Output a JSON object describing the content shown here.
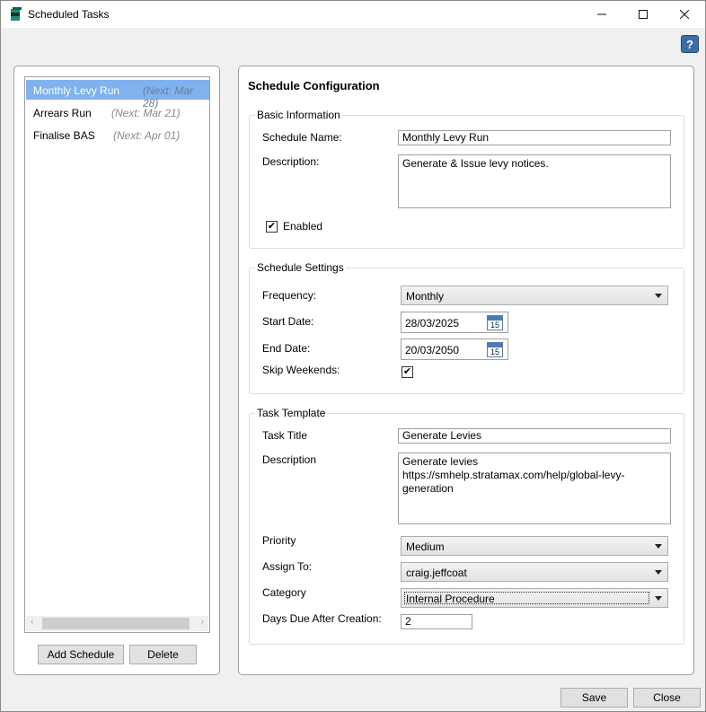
{
  "window": {
    "title": "Scheduled Tasks",
    "minimize_icon": "minimize-icon",
    "maximize_icon": "maximize-icon",
    "close_icon": "close-icon",
    "help_label": "?"
  },
  "schedules": [
    {
      "name": "Monthly Levy Run",
      "next": "(Next: Mar 28)",
      "selected": true
    },
    {
      "name": "Arrears Run",
      "next": "(Next: Mar 21)",
      "selected": false
    },
    {
      "name": "Finalise BAS",
      "next": "(Next: Apr 01)",
      "selected": false
    }
  ],
  "left_buttons": {
    "add": "Add Schedule",
    "delete": "Delete"
  },
  "config": {
    "title": "Schedule Configuration",
    "basic": {
      "legend": "Basic Information",
      "name_label": "Schedule Name:",
      "name_value": "Monthly Levy Run",
      "desc_label": "Description:",
      "desc_value": "Generate & Issue levy notices.",
      "enabled_label": "Enabled",
      "enabled": true
    },
    "settings": {
      "legend": "Schedule Settings",
      "frequency_label": "Frequency:",
      "frequency_value": "Monthly",
      "start_label": "Start Date:",
      "start_value": "28/03/2025",
      "end_label": "End Date:",
      "end_value": "20/03/2050",
      "calendar_day": "15",
      "skip_label": "Skip Weekends:",
      "skip_weekends": true
    },
    "template": {
      "legend": "Task Template",
      "title_label": "Task Title",
      "title_value": "Generate Levies",
      "desc_label": "Description",
      "desc_value": "Generate levies\nhttps://smhelp.stratamax.com/help/global-levy-\ngeneration",
      "priority_label": "Priority",
      "priority_value": "Medium",
      "assign_label": "Assign To:",
      "assign_value": "craig.jeffcoat",
      "category_label": "Category",
      "category_value": "Internal Procedure",
      "days_label": "Days Due After Creation:",
      "days_value": "2"
    }
  },
  "footer": {
    "save": "Save",
    "close": "Close"
  },
  "colors": {
    "selection": "#7fb2ee",
    "help_button": "#3a6ea5"
  }
}
